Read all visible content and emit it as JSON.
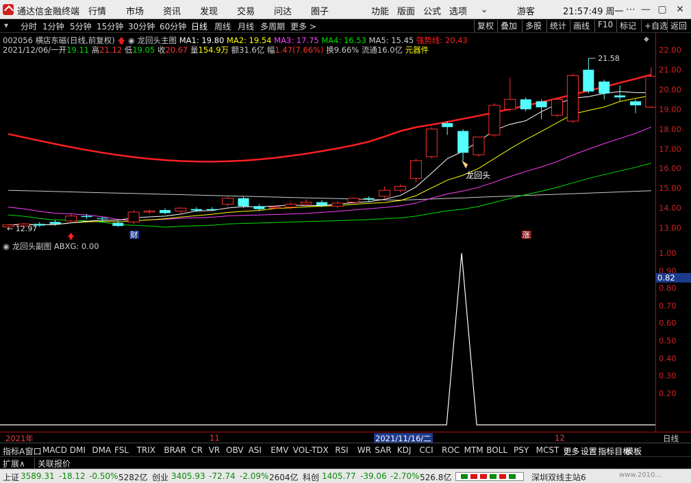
{
  "app": {
    "title": "通达信金融终端",
    "login": "游客",
    "clock": "21:57:49 周一"
  },
  "menu": [
    "行情",
    "市场",
    "资讯",
    "发现",
    "交易",
    "问达",
    "圈子"
  ],
  "menu_right": [
    "功能",
    "版面",
    "公式",
    "选项"
  ],
  "periods": [
    "分时",
    "1分钟",
    "5分钟",
    "15分钟",
    "30分钟",
    "60分钟",
    "日线",
    "周线",
    "月线",
    "多周期",
    "更多 >"
  ],
  "right_buttons": [
    "复权",
    "叠加",
    "多股",
    "统计",
    "画线",
    "F10",
    "标记",
    "+自选",
    "返回"
  ],
  "stock": {
    "code": "002056",
    "name": "横店东磁(日线,前复权)",
    "indicator": "龙回头主图",
    "ma1": "MA1: 19.80",
    "ma2": "MA2: 19.54",
    "ma3": "MA3: 17.75",
    "ma4": "MA4: 16.53",
    "ma5": "MA5: 15.45",
    "trend": "强势线: 20.43"
  },
  "quote": {
    "date": "2021/12/06/一",
    "open_l": "开",
    "open": "19.11",
    "high_l": "高",
    "high": "21.12",
    "low_l": "低",
    "low": "19.05",
    "close_l": "收",
    "close": "20.67",
    "vol_l": "量",
    "vol": "154.9万",
    "amt_l": "额",
    "amt": "31.6亿",
    "chg_l": "幅",
    "chg": "1.47(7.66%)",
    "turn_l": "换",
    "turn": "9.66%",
    "float_l": "流通",
    "float": "16.0亿",
    "sector": "元器件"
  },
  "annotations": {
    "max": "21.58",
    "min": "12.97",
    "signal": "龙回头",
    "cai": "财",
    "zhang": "涨"
  },
  "main_axis": [
    "22.00",
    "21.00",
    "20.00",
    "19.00",
    "18.00",
    "17.00",
    "16.00",
    "15.00",
    "14.00",
    "13.00"
  ],
  "sub": {
    "title": "龙回头副图",
    "abxg": "ABXG: 0.00",
    "current": "0.82"
  },
  "sub_axis": [
    "1.00",
    "0.90",
    "0.80",
    "0.70",
    "0.60",
    "0.50",
    "0.40",
    "0.30",
    "0.20"
  ],
  "datebar": {
    "year": "2021年",
    "month": "11",
    "cursor": "2021/11/16/二",
    "month2": "12",
    "right": "日线"
  },
  "indicator_tabs": [
    "指标A",
    "窗口",
    "MACD",
    "DMI",
    "DMA",
    "FSL",
    "TRIX",
    "BRAR",
    "CR",
    "VR",
    "OBV",
    "ASI",
    "EMV",
    "VOL-TDX",
    "RSI",
    "WR",
    "SAR",
    "KDJ",
    "CCI",
    "ROC",
    "MTM",
    "BOLL",
    "PSY",
    "MCST",
    "更多",
    "设置",
    "指标目标",
    "模板"
  ],
  "sub_row": [
    "扩展∧",
    "关联报价"
  ],
  "status": {
    "sh_l": "上证",
    "sh": "3589.31",
    "sh_c": "-18.12",
    "sh_p": "-0.50%",
    "sh_a": "5282亿",
    "cy_l": "创业",
    "cy": "3405.93",
    "cy_c": "-72.74",
    "cy_p": "-2.09%",
    "cy_a": "2604亿",
    "kc_l": "科创",
    "kc": "1405.77",
    "kc_c": "-39.06",
    "kc_p": "-2.70%",
    "kc_a": "526.8亿",
    "server": "深圳双线主站6",
    "watermark": "www.2010..."
  },
  "chart_data": {
    "type": "candlestick",
    "ylim": [
      12.7,
      22.4
    ],
    "candles": [
      [
        13.05,
        13.15,
        12.97,
        13.18
      ],
      [
        13.1,
        13.2,
        13.05,
        13.25
      ],
      [
        13.2,
        13.12,
        13.05,
        13.3
      ],
      [
        13.3,
        13.2,
        13.1,
        13.4
      ],
      [
        13.35,
        13.6,
        13.25,
        13.7
      ],
      [
        13.6,
        13.55,
        13.45,
        13.7
      ],
      [
        13.5,
        13.48,
        13.3,
        13.55
      ],
      [
        13.25,
        13.1,
        13.05,
        13.35
      ],
      [
        13.3,
        13.8,
        13.2,
        13.9
      ],
      [
        13.8,
        13.85,
        13.7,
        13.95
      ],
      [
        13.9,
        13.75,
        13.7,
        14.0
      ],
      [
        13.85,
        14.0,
        13.75,
        14.05
      ],
      [
        13.95,
        13.88,
        13.8,
        14.05
      ],
      [
        13.95,
        13.9,
        13.85,
        14.05
      ],
      [
        14.2,
        14.5,
        14.1,
        14.6
      ],
      [
        14.5,
        14.1,
        14.0,
        14.6
      ],
      [
        14.1,
        13.95,
        13.85,
        14.2
      ],
      [
        14.0,
        14.05,
        13.95,
        14.15
      ],
      [
        14.05,
        14.2,
        13.95,
        14.3
      ],
      [
        14.2,
        14.3,
        14.1,
        14.45
      ],
      [
        14.3,
        14.15,
        14.05,
        14.4
      ],
      [
        14.1,
        14.25,
        14.0,
        14.35
      ],
      [
        14.3,
        14.5,
        14.2,
        14.55
      ],
      [
        14.5,
        14.45,
        14.3,
        14.6
      ],
      [
        14.6,
        14.9,
        14.5,
        15.1
      ],
      [
        14.9,
        15.1,
        14.8,
        15.2
      ],
      [
        15.5,
        16.4,
        15.3,
        16.5
      ],
      [
        16.6,
        18.0,
        16.5,
        18.1
      ],
      [
        18.3,
        18.1,
        17.7,
        18.4
      ],
      [
        17.9,
        16.8,
        16.4,
        18.0
      ],
      [
        16.7,
        17.6,
        16.6,
        17.6
      ],
      [
        17.7,
        19.2,
        17.6,
        19.3
      ],
      [
        19.0,
        19.5,
        18.9,
        20.6
      ],
      [
        19.5,
        19.0,
        18.9,
        19.6
      ],
      [
        19.4,
        19.1,
        18.5,
        19.5
      ],
      [
        18.7,
        19.5,
        18.6,
        19.5
      ],
      [
        18.4,
        20.7,
        18.3,
        20.8
      ],
      [
        21.0,
        19.9,
        19.8,
        21.58
      ],
      [
        20.4,
        19.8,
        19.5,
        20.5
      ],
      [
        19.7,
        19.6,
        19.4,
        20.2
      ],
      [
        19.4,
        19.2,
        18.8,
        19.5
      ],
      [
        19.11,
        20.67,
        19.05,
        21.12
      ]
    ],
    "signal_index": 29,
    "sub_signal": 1.0
  }
}
